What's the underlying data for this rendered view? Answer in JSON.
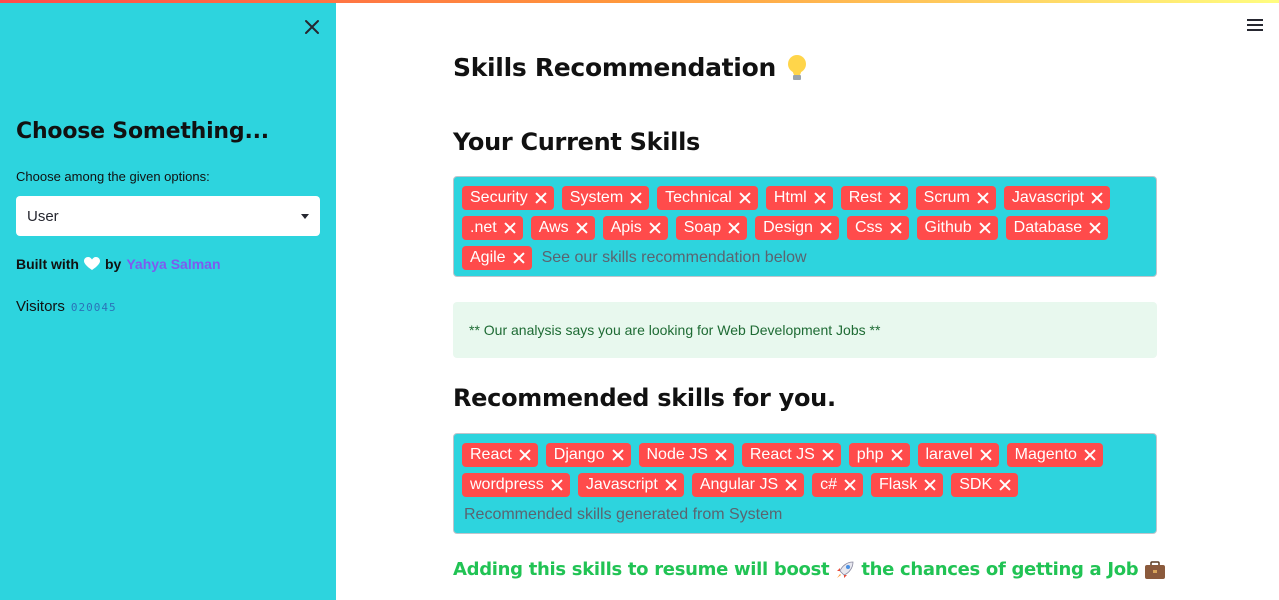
{
  "sidebar": {
    "title": "Choose Something...",
    "select_label": "Choose among the given options:",
    "select_value": "User",
    "built_with_prefix": "Built with",
    "built_with_by": "by",
    "author": "Yahya Salman",
    "visitors_label": "Visitors",
    "visitors_count": "020045"
  },
  "main": {
    "title": "Skills Recommendation",
    "current_heading": "Your Current Skills",
    "current_skills": [
      "Security",
      "System",
      "Technical",
      "Html",
      "Rest",
      "Scrum",
      "Javascript",
      ".net",
      "Aws",
      "Apis",
      "Soap",
      "Design",
      "Css",
      "Github",
      "Database",
      "Agile"
    ],
    "current_placeholder": "See our skills recommendation below",
    "analysis_text": "** Our analysis says you are looking for Web Development Jobs **",
    "recommended_heading": "Recommended skills for you.",
    "recommended_skills": [
      "React",
      "Django",
      "Node JS",
      "React JS",
      "php",
      "laravel",
      "Magento",
      "wordpress",
      "Javascript",
      "Angular JS",
      "c#",
      "Flask",
      "SDK"
    ],
    "recommended_placeholder": "Recommended skills generated from System",
    "boost_text_1": "Adding this skills to resume will boost",
    "boost_text_2": "the chances of getting a Job"
  },
  "colors": {
    "sidebar_bg": "#2dd4de",
    "tag_bg": "#ff4b4b",
    "success_text": "#21c354",
    "info_bg": "#e8f8ee"
  },
  "icons": [
    "close-icon",
    "hamburger-menu-icon",
    "lightbulb-icon",
    "heart-icon",
    "rocket-icon",
    "briefcase-icon",
    "chevron-down-icon"
  ]
}
